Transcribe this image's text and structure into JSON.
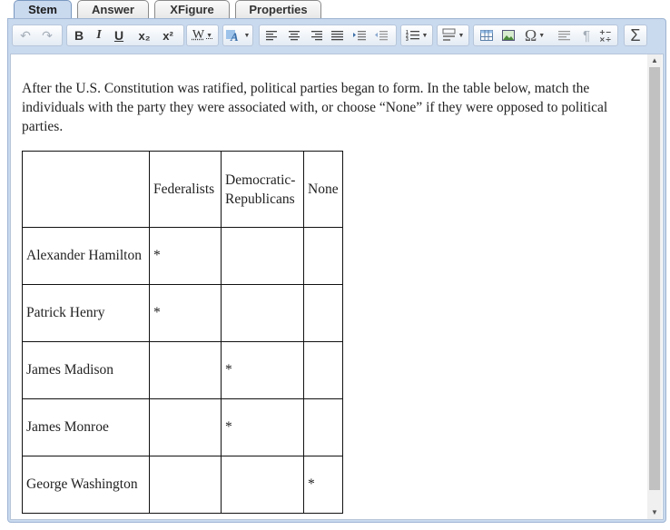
{
  "tabs": [
    {
      "label": "Stem",
      "active": true
    },
    {
      "label": "Answer",
      "active": false
    },
    {
      "label": "XFigure",
      "active": false
    },
    {
      "label": "Properties",
      "active": false
    }
  ],
  "toolbar": {
    "bold": "B",
    "italic": "I",
    "underline": "U",
    "subscript": "x₂",
    "superscript": "x²",
    "word_count": "W",
    "omega": "Ω",
    "pilcrow": "¶",
    "sigma": "Σ"
  },
  "stem_text": "After the U.S. Constitution was ratified, political parties began to form. In the table below, match the individuals with the party they were associated with, or choose “None” if they were opposed to political parties.",
  "table": {
    "headers": [
      "",
      "Federalists",
      "Democratic-Republicans",
      "None"
    ],
    "rows": [
      {
        "name": "Alexander Hamilton",
        "cells": [
          "*",
          "",
          ""
        ]
      },
      {
        "name": "Patrick Henry",
        "cells": [
          "*",
          "",
          ""
        ]
      },
      {
        "name": "James Madison",
        "cells": [
          "",
          "*",
          ""
        ]
      },
      {
        "name": "James Monroe",
        "cells": [
          "",
          "*",
          ""
        ]
      },
      {
        "name": "George Washington",
        "cells": [
          "",
          "",
          "*"
        ]
      }
    ]
  },
  "colors": {
    "frame": "#c9d9ee",
    "active_tab": "#c9d9ee",
    "toolbar_icon": "#333333"
  }
}
